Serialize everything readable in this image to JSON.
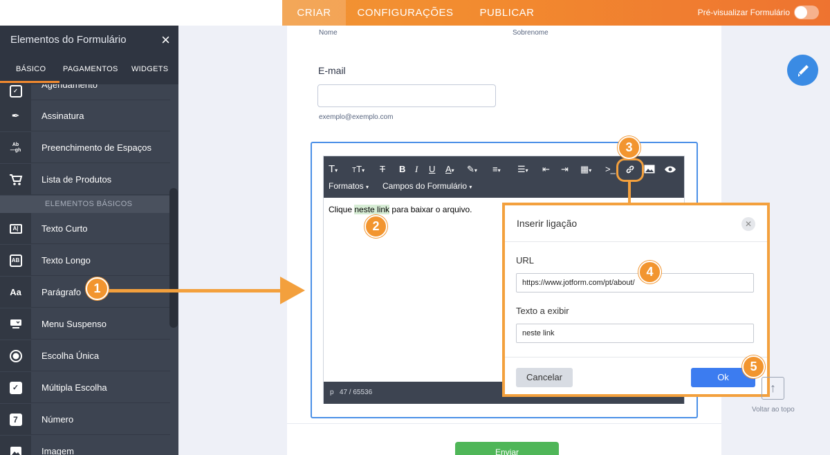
{
  "topbar": {
    "tabs": [
      "CRIAR",
      "CONFIGURAÇÕES",
      "PUBLICAR"
    ],
    "preview_label": "Pré-visualizar Formulário"
  },
  "sidebar": {
    "title": "Elementos do Formulário",
    "close_icon": "×",
    "tabs": [
      "BÁSICO",
      "PAGAMENTOS",
      "WIDGETS"
    ],
    "items_top": [
      {
        "label": "Agendamento",
        "icon": "checkbox-icon"
      },
      {
        "label": "Assinatura",
        "icon": "pen-icon"
      },
      {
        "label": "Preenchimento de Espaços",
        "icon": "fill-blank-icon",
        "glyph": "Ab\n—gh"
      },
      {
        "label": "Lista de Produtos",
        "icon": "cart-icon"
      }
    ],
    "section": "ELEMENTOS BÁSICOS",
    "items_basic": [
      {
        "label": "Texto Curto",
        "icon": "short-text-icon"
      },
      {
        "label": "Texto Longo",
        "icon": "long-text-icon"
      },
      {
        "label": "Parágrafo",
        "icon": "paragraph-icon",
        "glyph": "Aa"
      },
      {
        "label": "Menu Suspenso",
        "icon": "dropdown-icon"
      },
      {
        "label": "Escolha Única",
        "icon": "radio-icon"
      },
      {
        "label": "Múltipla Escolha",
        "icon": "checkbox-icon"
      },
      {
        "label": "Número",
        "icon": "number-icon",
        "glyph": "7"
      },
      {
        "label": "Imagem",
        "icon": "image-icon"
      }
    ]
  },
  "form": {
    "first_name_label": "Nome",
    "last_name_label": "Sobrenome",
    "email_title": "E-mail",
    "email_hint": "exemplo@exemplo.com",
    "submit_label": "Enviar"
  },
  "editor": {
    "toolbar_row2": [
      "Formatos",
      "Campos do Formulário"
    ],
    "content_before": "Clique ",
    "content_link": "neste link",
    "content_after": " para baixar o arquivo.",
    "status_tag": "p",
    "status_count": "47 / 65536"
  },
  "dialog": {
    "title": "Inserir ligação",
    "url_label": "URL",
    "url_value": "https://www.jotform.com/pt/about/",
    "text_label": "Texto a exibir",
    "text_value": "neste link",
    "cancel_label": "Cancelar",
    "ok_label": "Ok"
  },
  "callouts": [
    "1",
    "2",
    "3",
    "4",
    "5"
  ],
  "back_to_top_label": "Voltar ao topo",
  "colors": {
    "accent_orange": "#f28a2f",
    "sidebar_bg": "#3d4451",
    "focus_blue": "#4a8fe7",
    "ok_blue": "#3c7cf0",
    "submit_green": "#4fb658"
  }
}
